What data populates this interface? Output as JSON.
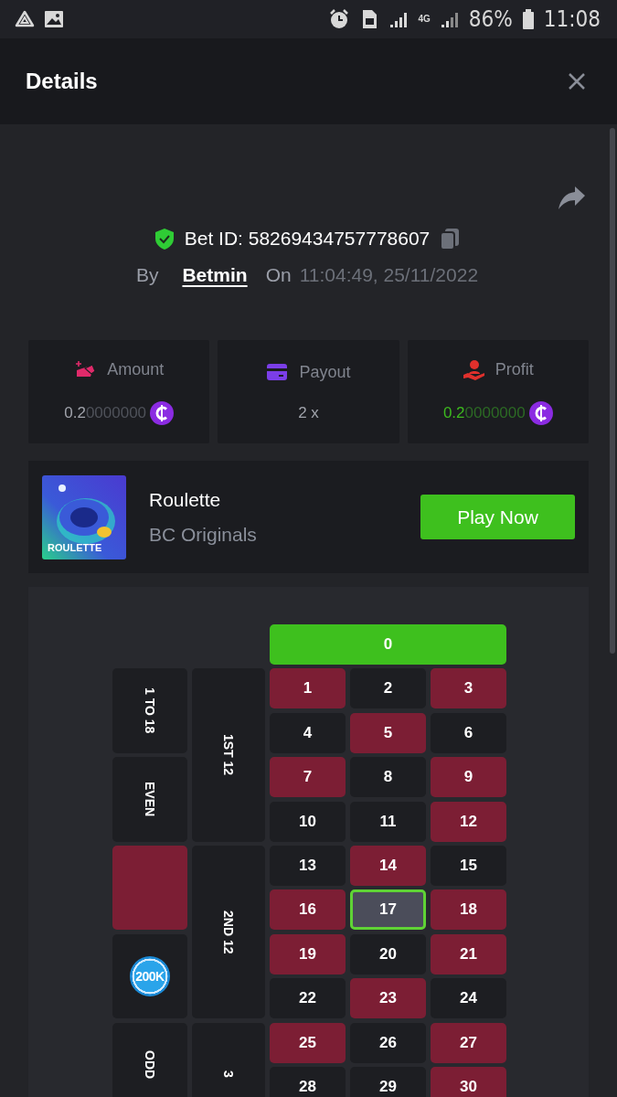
{
  "status_bar": {
    "network": "4G",
    "battery": "86%",
    "time": "11:08"
  },
  "header": {
    "title": "Details"
  },
  "bet": {
    "bet_id": "Bet ID: 58269434757778607",
    "by_label": "By",
    "user": "Betmin",
    "on_label": "On",
    "datetime": "11:04:49, 25/11/2022"
  },
  "stats": [
    {
      "kind": "amount",
      "label": "Amount",
      "value": "0.2",
      "value_rest": "0000000"
    },
    {
      "kind": "payout",
      "label": "Payout",
      "value": "2 x"
    },
    {
      "kind": "profit",
      "label": "Profit",
      "value": "0.2",
      "value_rest": "0000000"
    }
  ],
  "game": {
    "thumbnail_label": "ROULETTE",
    "name": "Roulette",
    "provider": "BC Originals",
    "button": "Play Now"
  },
  "board": {
    "zero": "0",
    "outside": [
      {
        "kind": "text",
        "label": "1 TO 18"
      },
      {
        "kind": "text",
        "label": "EVEN"
      },
      {
        "kind": "color",
        "color": "#7c1e34"
      },
      {
        "kind": "chip",
        "label": "200K"
      },
      {
        "kind": "text",
        "label": "ODD"
      }
    ],
    "dozens": [
      "1ST 12",
      "2ND 12",
      "3"
    ],
    "numbers": [
      {
        "label": "1",
        "color": "#7c1e34",
        "selected": false
      },
      {
        "label": "2",
        "color": "#1d1e22",
        "selected": false
      },
      {
        "label": "3",
        "color": "#7c1e34",
        "selected": false
      },
      {
        "label": "4",
        "color": "#1d1e22",
        "selected": false
      },
      {
        "label": "5",
        "color": "#7c1e34",
        "selected": false
      },
      {
        "label": "6",
        "color": "#1d1e22",
        "selected": false
      },
      {
        "label": "7",
        "color": "#7c1e34",
        "selected": false
      },
      {
        "label": "8",
        "color": "#1d1e22",
        "selected": false
      },
      {
        "label": "9",
        "color": "#7c1e34",
        "selected": false
      },
      {
        "label": "10",
        "color": "#1d1e22",
        "selected": false
      },
      {
        "label": "11",
        "color": "#1d1e22",
        "selected": false
      },
      {
        "label": "12",
        "color": "#7c1e34",
        "selected": false
      },
      {
        "label": "13",
        "color": "#1d1e22",
        "selected": false
      },
      {
        "label": "14",
        "color": "#7c1e34",
        "selected": false
      },
      {
        "label": "15",
        "color": "#1d1e22",
        "selected": false
      },
      {
        "label": "16",
        "color": "#7c1e34",
        "selected": false
      },
      {
        "label": "17",
        "color": "#4b4d5a",
        "selected": true
      },
      {
        "label": "18",
        "color": "#7c1e34",
        "selected": false
      },
      {
        "label": "19",
        "color": "#7c1e34",
        "selected": false
      },
      {
        "label": "20",
        "color": "#1d1e22",
        "selected": false
      },
      {
        "label": "21",
        "color": "#7c1e34",
        "selected": false
      },
      {
        "label": "22",
        "color": "#1d1e22",
        "selected": false
      },
      {
        "label": "23",
        "color": "#7c1e34",
        "selected": false
      },
      {
        "label": "24",
        "color": "#1d1e22",
        "selected": false
      },
      {
        "label": "25",
        "color": "#7c1e34",
        "selected": false
      },
      {
        "label": "26",
        "color": "#1d1e22",
        "selected": false
      },
      {
        "label": "27",
        "color": "#7c1e34",
        "selected": false
      },
      {
        "label": "28",
        "color": "#1d1e22",
        "selected": false
      },
      {
        "label": "29",
        "color": "#1d1e22",
        "selected": false
      },
      {
        "label": "30",
        "color": "#7c1e34",
        "selected": false
      }
    ]
  }
}
